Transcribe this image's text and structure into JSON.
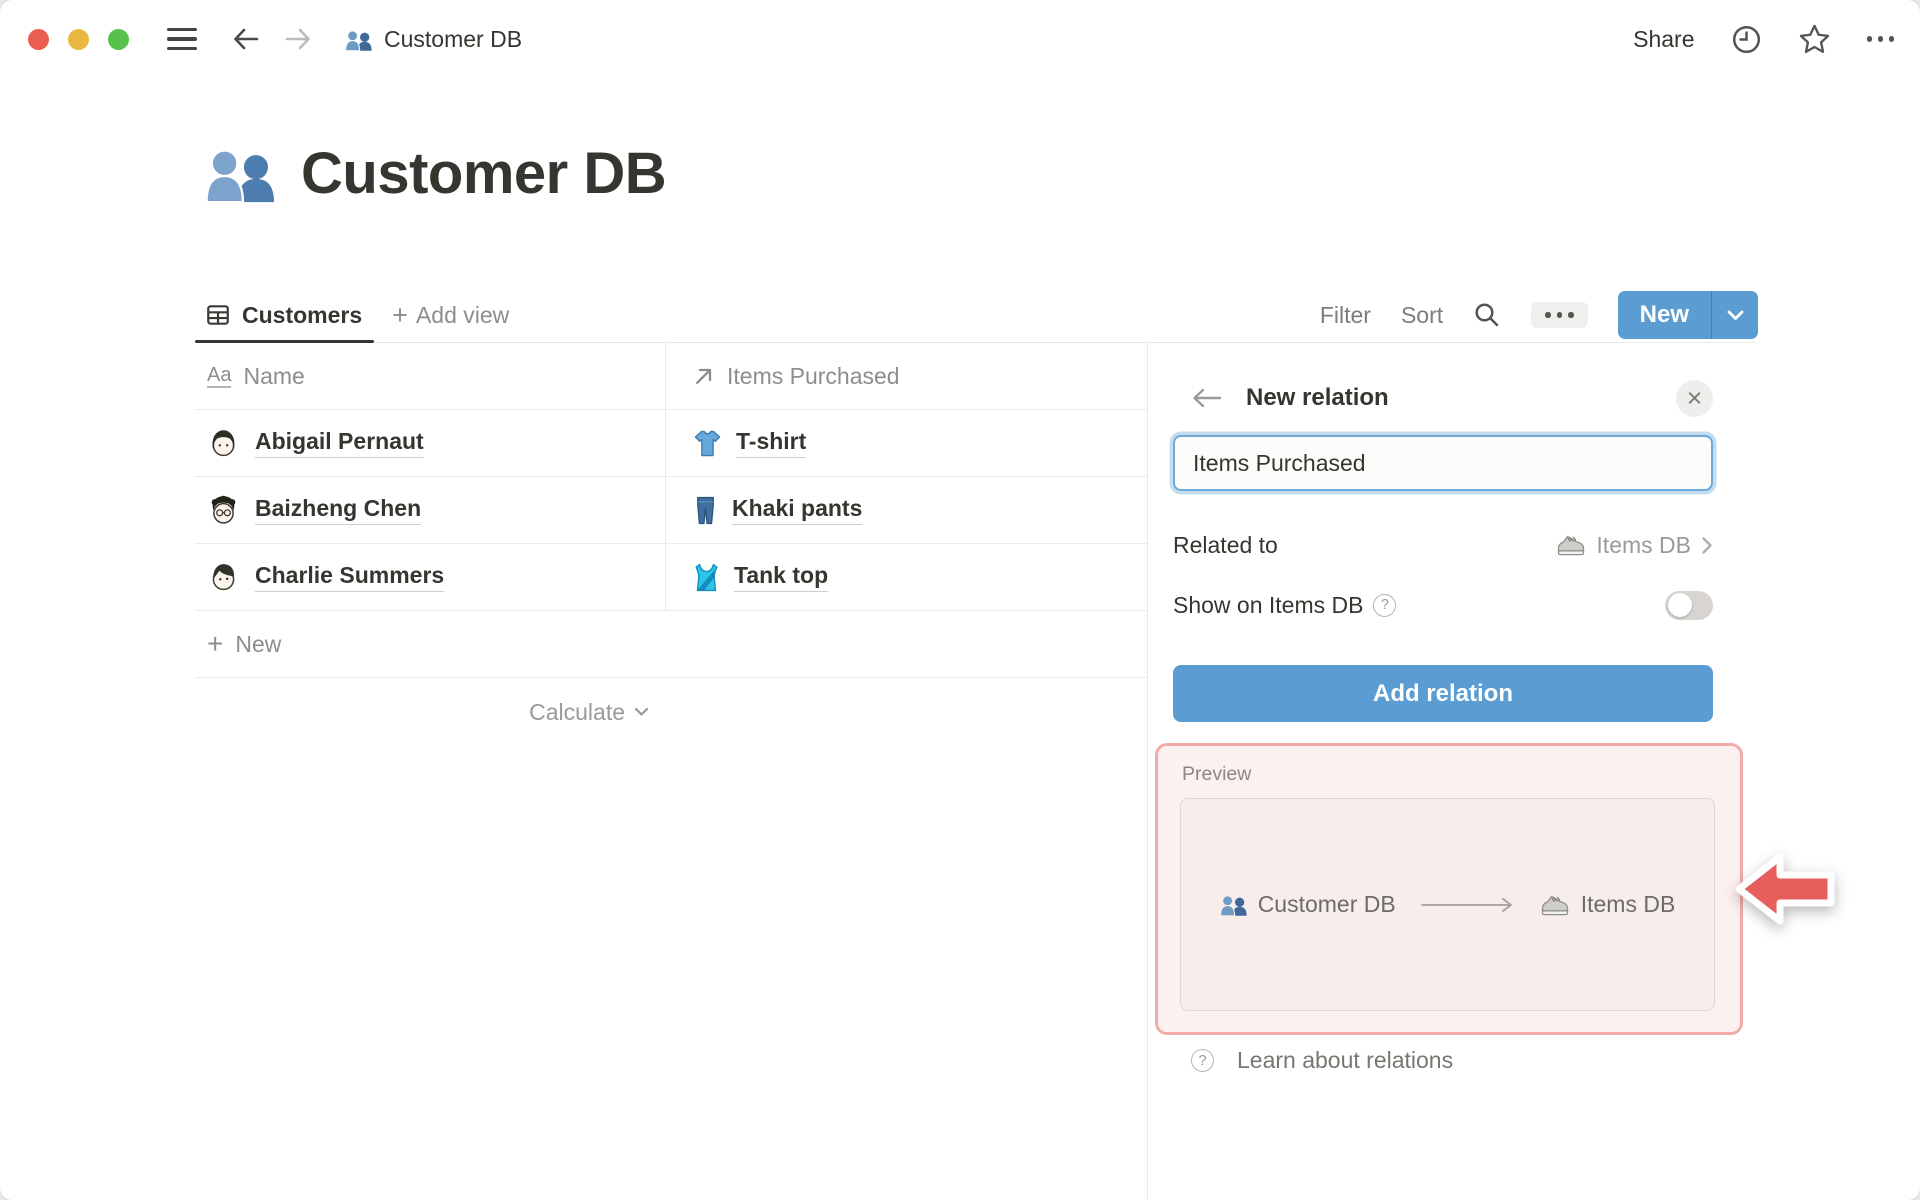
{
  "topbar": {
    "breadcrumb_title": "Customer DB",
    "share_label": "Share"
  },
  "page": {
    "title": "Customer DB",
    "icon": "people-icon"
  },
  "views": {
    "active_tab": "Customers",
    "add_view_label": "Add view"
  },
  "toolbar": {
    "filter_label": "Filter",
    "sort_label": "Sort",
    "new_label": "New"
  },
  "table": {
    "columns": [
      {
        "label": "Name",
        "icon": "text-property-icon"
      },
      {
        "label": "Items Purchased",
        "icon": "relation-arrow-icon"
      }
    ],
    "rows": [
      {
        "name": "Abigail Pernaut",
        "item": "T-shirt",
        "item_icon": "t-shirt-icon"
      },
      {
        "name": "Baizheng Chen",
        "item": "Khaki pants",
        "item_icon": "jeans-icon"
      },
      {
        "name": "Charlie Summers",
        "item": "Tank top",
        "item_icon": "tank-top-icon"
      }
    ],
    "new_row_label": "New",
    "calculate_label": "Calculate"
  },
  "panel": {
    "title": "New relation",
    "name_input_value": "Items Purchased",
    "related_to_label": "Related to",
    "related_to_value": "Items DB",
    "related_to_icon": "sneaker-icon",
    "show_on_label": "Show on Items DB",
    "toggle_state": "off",
    "add_button_label": "Add relation",
    "preview": {
      "label": "Preview",
      "source": "Customer DB",
      "source_icon": "people-icon",
      "target": "Items DB",
      "target_icon": "sneaker-icon"
    },
    "learn_label": "Learn about relations"
  },
  "colors": {
    "accent_blue": "#5b9dd2",
    "focus_ring": "#c3dcef",
    "annotation_red": "#e75f5c",
    "annotation_pink_border": "#f1aca9",
    "annotation_pink_bg": "#fcf1f0",
    "traffic_red": "#ea5e52",
    "traffic_yellow": "#e9b83e",
    "traffic_green": "#58c14e",
    "text_dark": "#37352f",
    "text_gray": "#9b9a97"
  }
}
